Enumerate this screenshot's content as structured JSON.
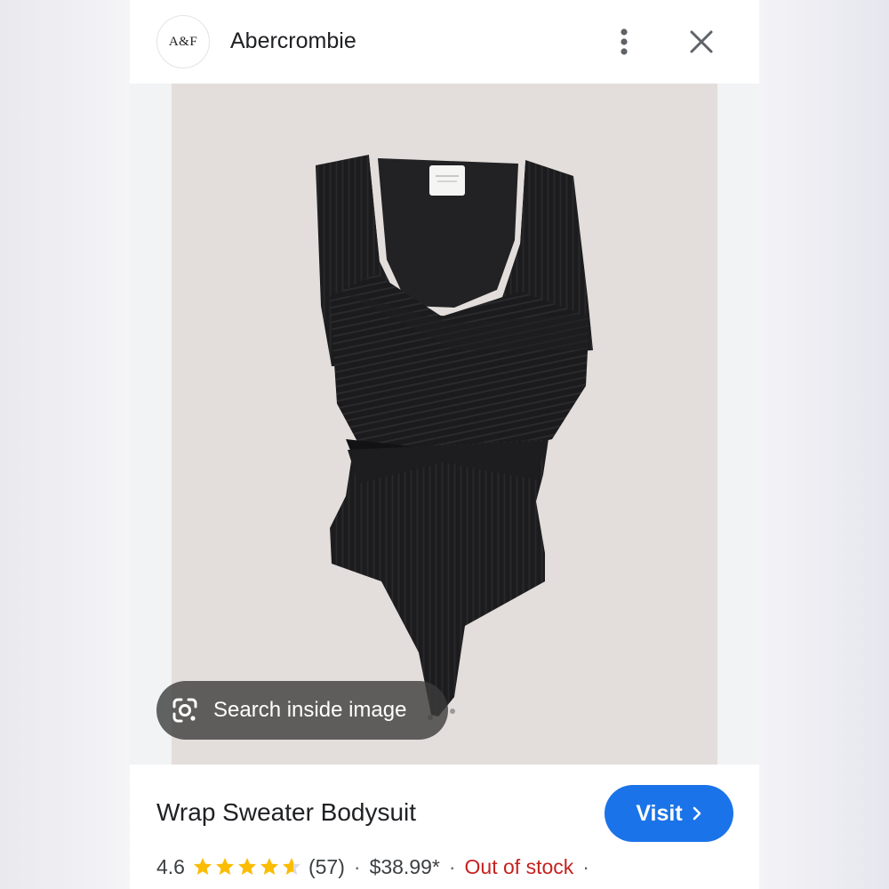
{
  "header": {
    "logo_text": "A&F",
    "brand_name": "Abercrombie",
    "more_icon": "more-vert-icon",
    "close_icon": "close-icon"
  },
  "image": {
    "subject": "black ribbed wrap sweater bodysuit",
    "background_color": "#e3dedb",
    "lens_button_label": "Search inside image",
    "lens_icon": "google-lens-icon"
  },
  "product": {
    "title": "Wrap Sweater Bodysuit",
    "visit_label": "Visit",
    "visit_icon": "chevron-right-icon",
    "rating": "4.6",
    "rating_value": 4.6,
    "review_count": "(57)",
    "price": "$38.99*",
    "availability": "Out of stock",
    "separator": "·"
  },
  "colors": {
    "accent": "#1a73e8",
    "star": "#fbbc04",
    "out_of_stock": "#c5221f"
  }
}
